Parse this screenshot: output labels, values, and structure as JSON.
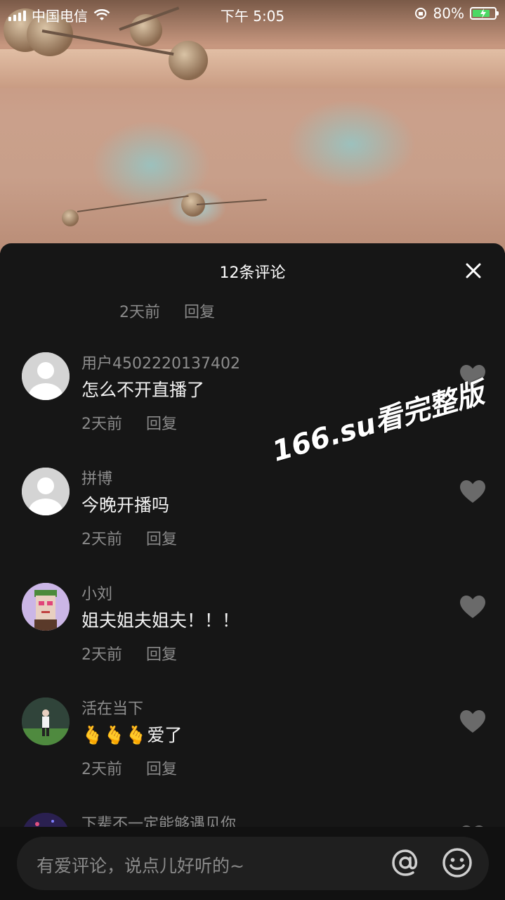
{
  "status_bar": {
    "carrier": "中国电信",
    "time": "下午 5:05",
    "battery": "80%"
  },
  "sheet": {
    "title": "12条评论",
    "top_meta": {
      "time": "2天前",
      "reply": "回复"
    }
  },
  "comments": [
    {
      "user": "用户4502220137402",
      "text": "怎么不开直播了",
      "time": "2天前",
      "reply": "回复"
    },
    {
      "user": "拼博",
      "text": "今晚开播吗",
      "time": "2天前",
      "reply": "回复"
    },
    {
      "user": "小刘",
      "text": "姐夫姐夫姐夫！！！",
      "time": "2天前",
      "reply": "回复"
    },
    {
      "user": "活在当下",
      "text": "🫰🫰🫰爱了",
      "time": "2天前",
      "reply": "回复"
    },
    {
      "user": "下辈不一定能够遇见你"
    }
  ],
  "watermark": "166.su看完整版",
  "input": {
    "placeholder": "有爱评论，说点儿好听的~"
  },
  "colors": {
    "sheet_bg": "#161616",
    "muted_text": "#8a8a8a",
    "battery": "#4cd964"
  }
}
